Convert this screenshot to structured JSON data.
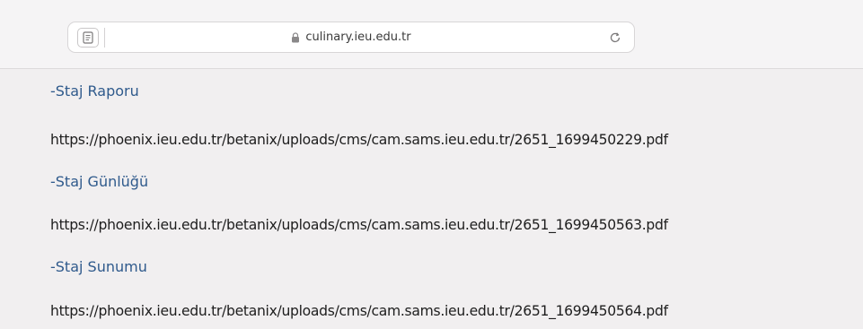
{
  "browser": {
    "url": "culinary.ieu.edu.tr",
    "reader_icon": "reader-mode-icon",
    "lock_icon": "lock-icon",
    "reload_icon": "reload-icon"
  },
  "content": {
    "entries": [
      {
        "title": "-Staj Raporu",
        "link": "https://phoenix.ieu.edu.tr/betanix/uploads/cms/cam.sams.ieu.edu.tr/2651_1699450229.pdf"
      },
      {
        "title": "-Staj Günlüğü",
        "link": "https://phoenix.ieu.edu.tr/betanix/uploads/cms/cam.sams.ieu.edu.tr/2651_1699450563.pdf"
      },
      {
        "title": "-Staj Sunumu",
        "link": "https://phoenix.ieu.edu.tr/betanix/uploads/cms/cam.sams.ieu.edu.tr/2651_1699450564.pdf"
      }
    ]
  },
  "colors": {
    "title": "#2f5a8c",
    "link": "#1e1e1e",
    "background": "#f1eff0"
  }
}
